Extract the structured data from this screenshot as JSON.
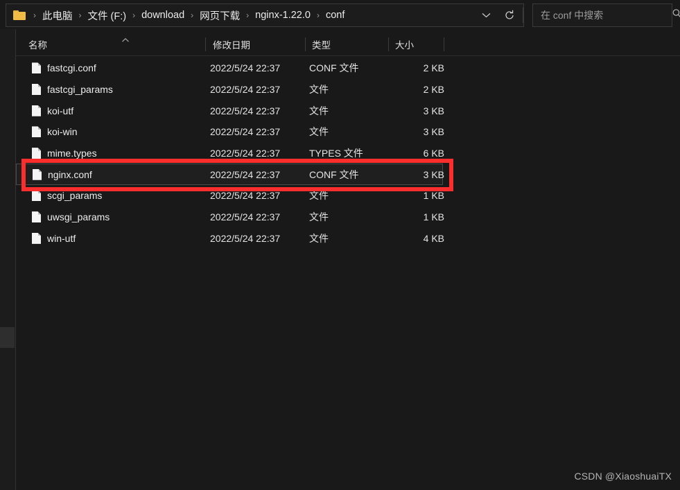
{
  "window": {
    "background_color": "#191919",
    "accent_color": "#fb2e2e"
  },
  "address_bar": {
    "folder_icon": "folder-icon",
    "separator": "›",
    "breadcrumbs": [
      {
        "label": "此电脑"
      },
      {
        "label": "文件 (F:)"
      },
      {
        "label": "download"
      },
      {
        "label": "网页下载"
      },
      {
        "label": "nginx-1.22.0"
      },
      {
        "label": "conf"
      }
    ],
    "history_dropdown_icon": "chevron-down-icon",
    "refresh_icon": "refresh-icon"
  },
  "search": {
    "placeholder": "在 conf 中搜索",
    "value": "",
    "icon": "search-icon"
  },
  "columns": {
    "name": "名称",
    "date_modified": "修改日期",
    "type": "类型",
    "size": "大小",
    "sort_indicator": "sort-ascending-icon"
  },
  "files": [
    {
      "name": "fastcgi.conf",
      "date": "2022/5/24 22:37",
      "type": "CONF 文件",
      "size": "2 KB",
      "selected": false
    },
    {
      "name": "fastcgi_params",
      "date": "2022/5/24 22:37",
      "type": "文件",
      "size": "2 KB",
      "selected": false
    },
    {
      "name": "koi-utf",
      "date": "2022/5/24 22:37",
      "type": "文件",
      "size": "3 KB",
      "selected": false
    },
    {
      "name": "koi-win",
      "date": "2022/5/24 22:37",
      "type": "文件",
      "size": "3 KB",
      "selected": false
    },
    {
      "name": "mime.types",
      "date": "2022/5/24 22:37",
      "type": "TYPES 文件",
      "size": "6 KB",
      "selected": false
    },
    {
      "name": "nginx.conf",
      "date": "2022/5/24 22:37",
      "type": "CONF 文件",
      "size": "3 KB",
      "selected": true
    },
    {
      "name": "scgi_params",
      "date": "2022/5/24 22:37",
      "type": "文件",
      "size": "1 KB",
      "selected": false
    },
    {
      "name": "uwsgi_params",
      "date": "2022/5/24 22:37",
      "type": "文件",
      "size": "1 KB",
      "selected": false
    },
    {
      "name": "win-utf",
      "date": "2022/5/24 22:37",
      "type": "文件",
      "size": "4 KB",
      "selected": false
    }
  ],
  "watermark": {
    "text": "CSDN @XiaoshuaiTX"
  }
}
